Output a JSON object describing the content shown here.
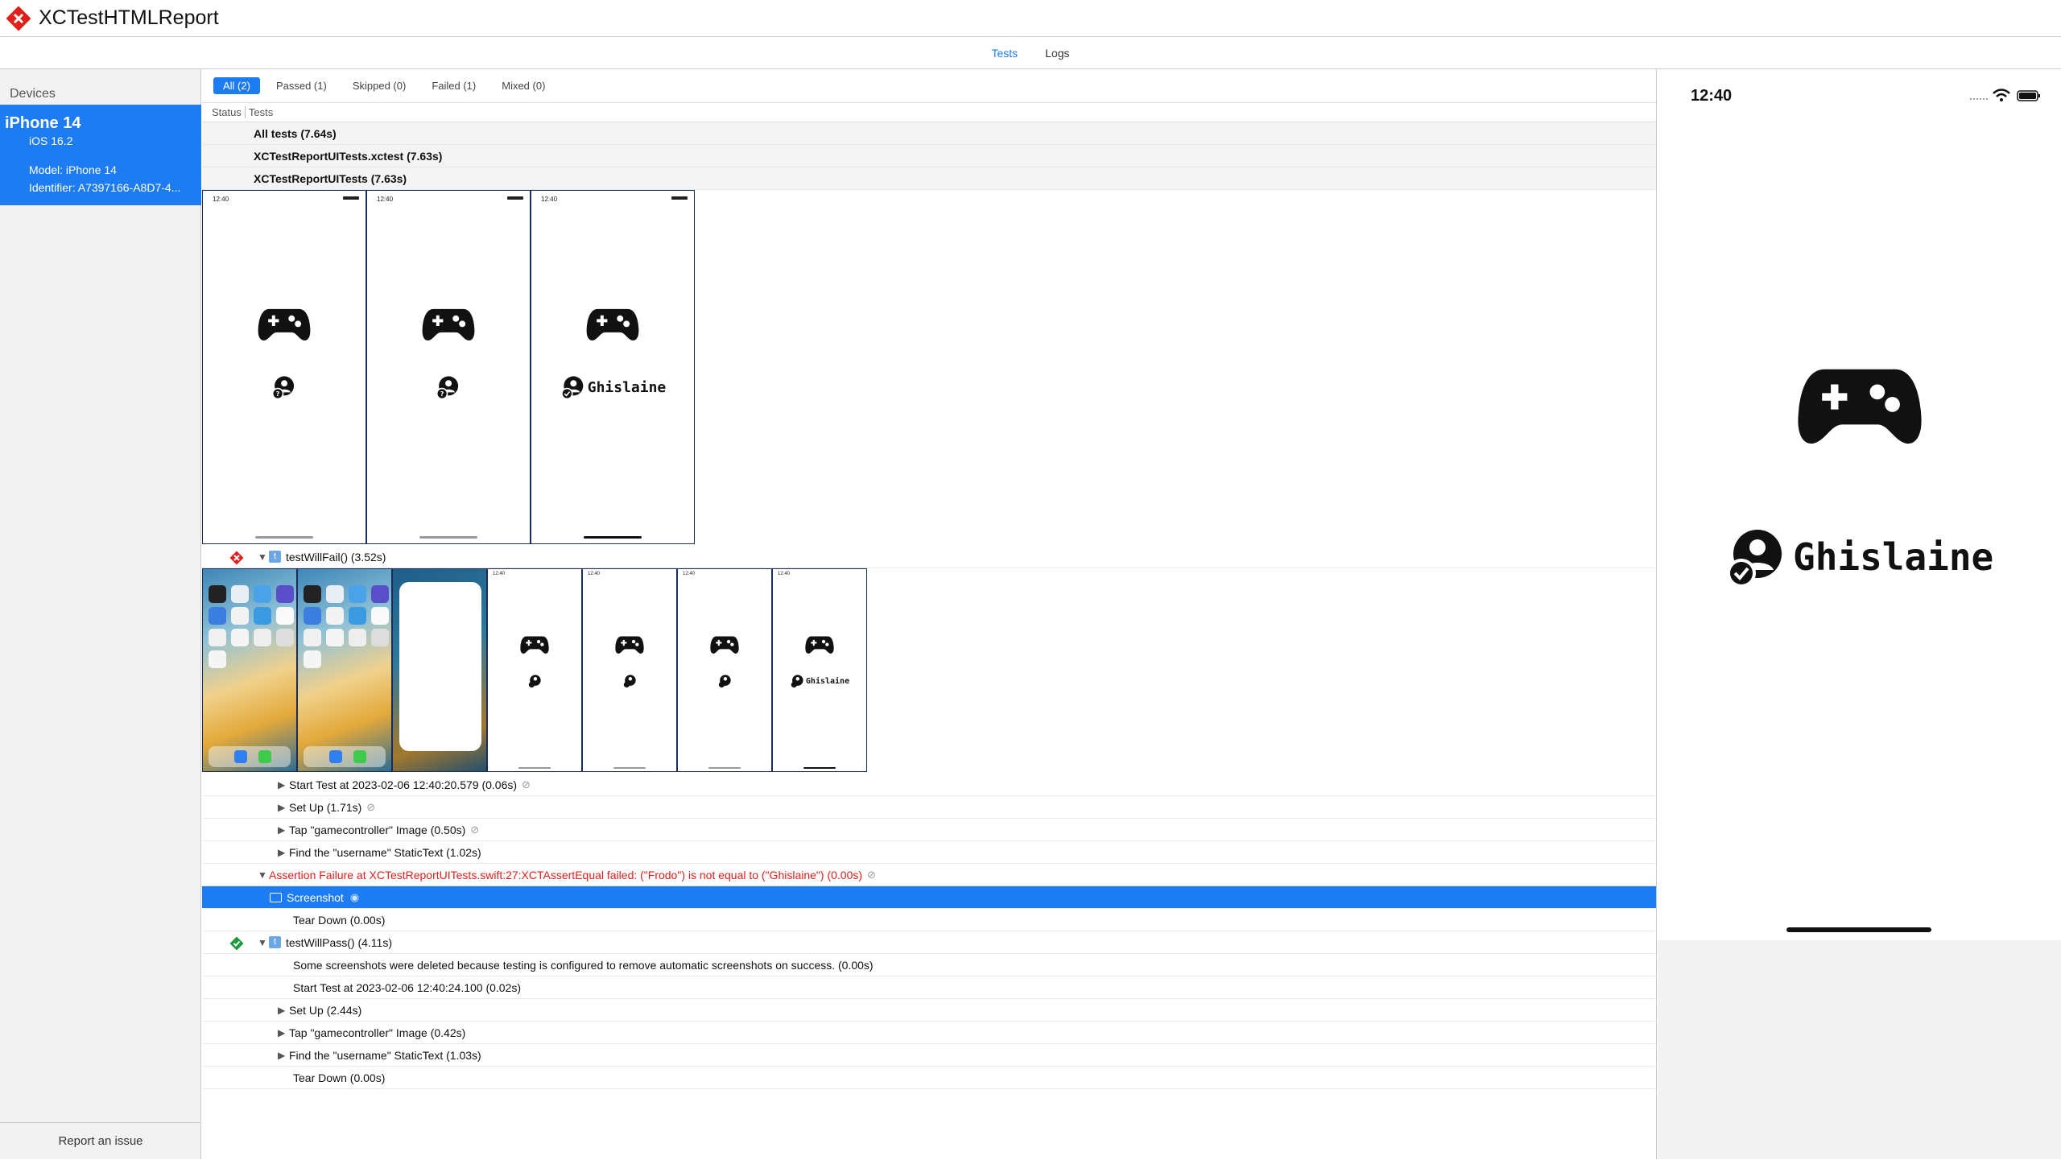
{
  "app": {
    "title": "XCTestHTMLReport",
    "logo_icon": "xcode-test-diamond-icon",
    "brand_color": "#e0201a"
  },
  "nav": {
    "tabs": [
      "Tests",
      "Logs"
    ],
    "active_tab": "Tests",
    "accent": "#1e7cf2"
  },
  "sidebar": {
    "heading": "Devices",
    "device": {
      "name": "iPhone 14",
      "os": "iOS 16.2",
      "model": "Model: iPhone 14",
      "identifier": "Identifier: A7397166-A8D7-4..."
    },
    "report_issue": "Report an issue"
  },
  "filters": [
    "All (2)",
    "Passed (1)",
    "Skipped (0)",
    "Failed (1)",
    "Mixed (0)"
  ],
  "columns": {
    "status": "Status",
    "tests": "Tests"
  },
  "groups": [
    "All tests (7.64s)",
    "XCTestReportUITests.xctest (7.63s)",
    "XCTestReportUITests (7.63s)"
  ],
  "top_screens": {
    "time": "12:40",
    "screens": [
      {
        "username": "",
        "verified": false
      },
      {
        "username": "",
        "verified": false
      },
      {
        "username": "Ghislaine",
        "verified": true
      }
    ]
  },
  "fail_test": {
    "status": "failed",
    "status_color": "#e0201a",
    "badge": "t",
    "label": "testWillFail() (3.52s)",
    "activities": [
      {
        "label": "Start Test at 2023-02-06 12:40:20.579 (0.06s)",
        "attachment": true
      },
      {
        "label": "Set Up (1.71s)",
        "attachment": true
      },
      {
        "label": "Tap \"gamecontroller\" Image (0.50s)",
        "attachment": true
      },
      {
        "label": "Find the \"username\" StaticText (1.02s)",
        "attachment": false
      }
    ],
    "assertion": "Assertion Failure at XCTestReportUITests.swift:27:XCTAssertEqual failed: (\"Frodo\") is not equal to (\"Ghislaine\") (0.00s)",
    "screenshot": "Screenshot",
    "teardown": "Tear Down (0.00s)",
    "strip_user": "Ghislaine"
  },
  "pass_test": {
    "status": "passed",
    "status_color": "#1a9a3c",
    "badge": "t",
    "label": "testWillPass() (4.11s)",
    "note": "Some screenshots were deleted because testing is configured to remove automatic screenshots on success. (0.00s)",
    "start": "Start Test at 2023-02-06 12:40:24.100 (0.02s)",
    "activities": [
      "Set Up (2.44s)",
      "Tap \"gamecontroller\" Image (0.42s)",
      "Find the \"username\" StaticText (1.03s)"
    ],
    "teardown": "Tear Down (0.00s)"
  },
  "preview": {
    "time": "12:40",
    "username": "Ghislaine"
  }
}
